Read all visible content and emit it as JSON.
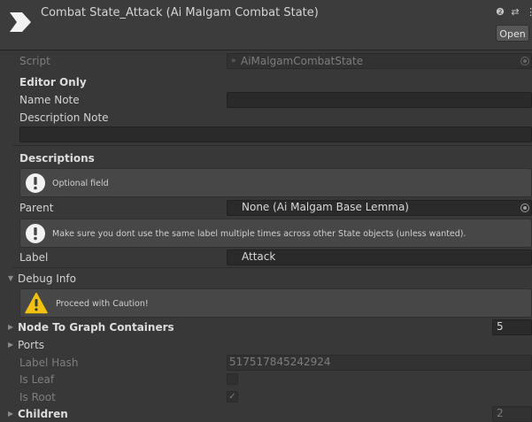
{
  "header": {
    "title": "Combat State_Attack (Ai Malgam Combat State)",
    "icons": "❷ ⇄ ⋮",
    "open_label": "Open"
  },
  "script": {
    "label": "Script",
    "value": "AiMalgamCombatState"
  },
  "editor_only": {
    "header": "Editor Only",
    "name_note_label": "Name Note",
    "name_note_value": "",
    "description_note_label": "Description Note",
    "description_note_value": ""
  },
  "descriptions": {
    "header": "Descriptions",
    "info_optional": "Optional field",
    "parent_label": "Parent",
    "parent_value": "None (Ai Malgam Base Lemma)",
    "info_label_warning": "Make sure you dont use the same label multiple times across other State objects (unless wanted).",
    "label_label": "Label",
    "label_value": "Attack"
  },
  "debug_info": {
    "header": "Debug Info",
    "caution": "Proceed with Caution!",
    "node_to_graph_label": "Node To Graph Containers",
    "node_to_graph_value": "5",
    "ports_label": "Ports",
    "label_hash_label": "Label Hash",
    "label_hash_value": "517517845242924",
    "is_leaf_label": "Is Leaf",
    "is_leaf_checked": false,
    "is_root_label": "Is Root",
    "is_root_checked": true,
    "children_label": "Children",
    "children_value": "2"
  },
  "colors": {
    "background": "#383838",
    "field": "#2a2a2a",
    "info_box": "#474747",
    "warning": "#f2c00e"
  }
}
